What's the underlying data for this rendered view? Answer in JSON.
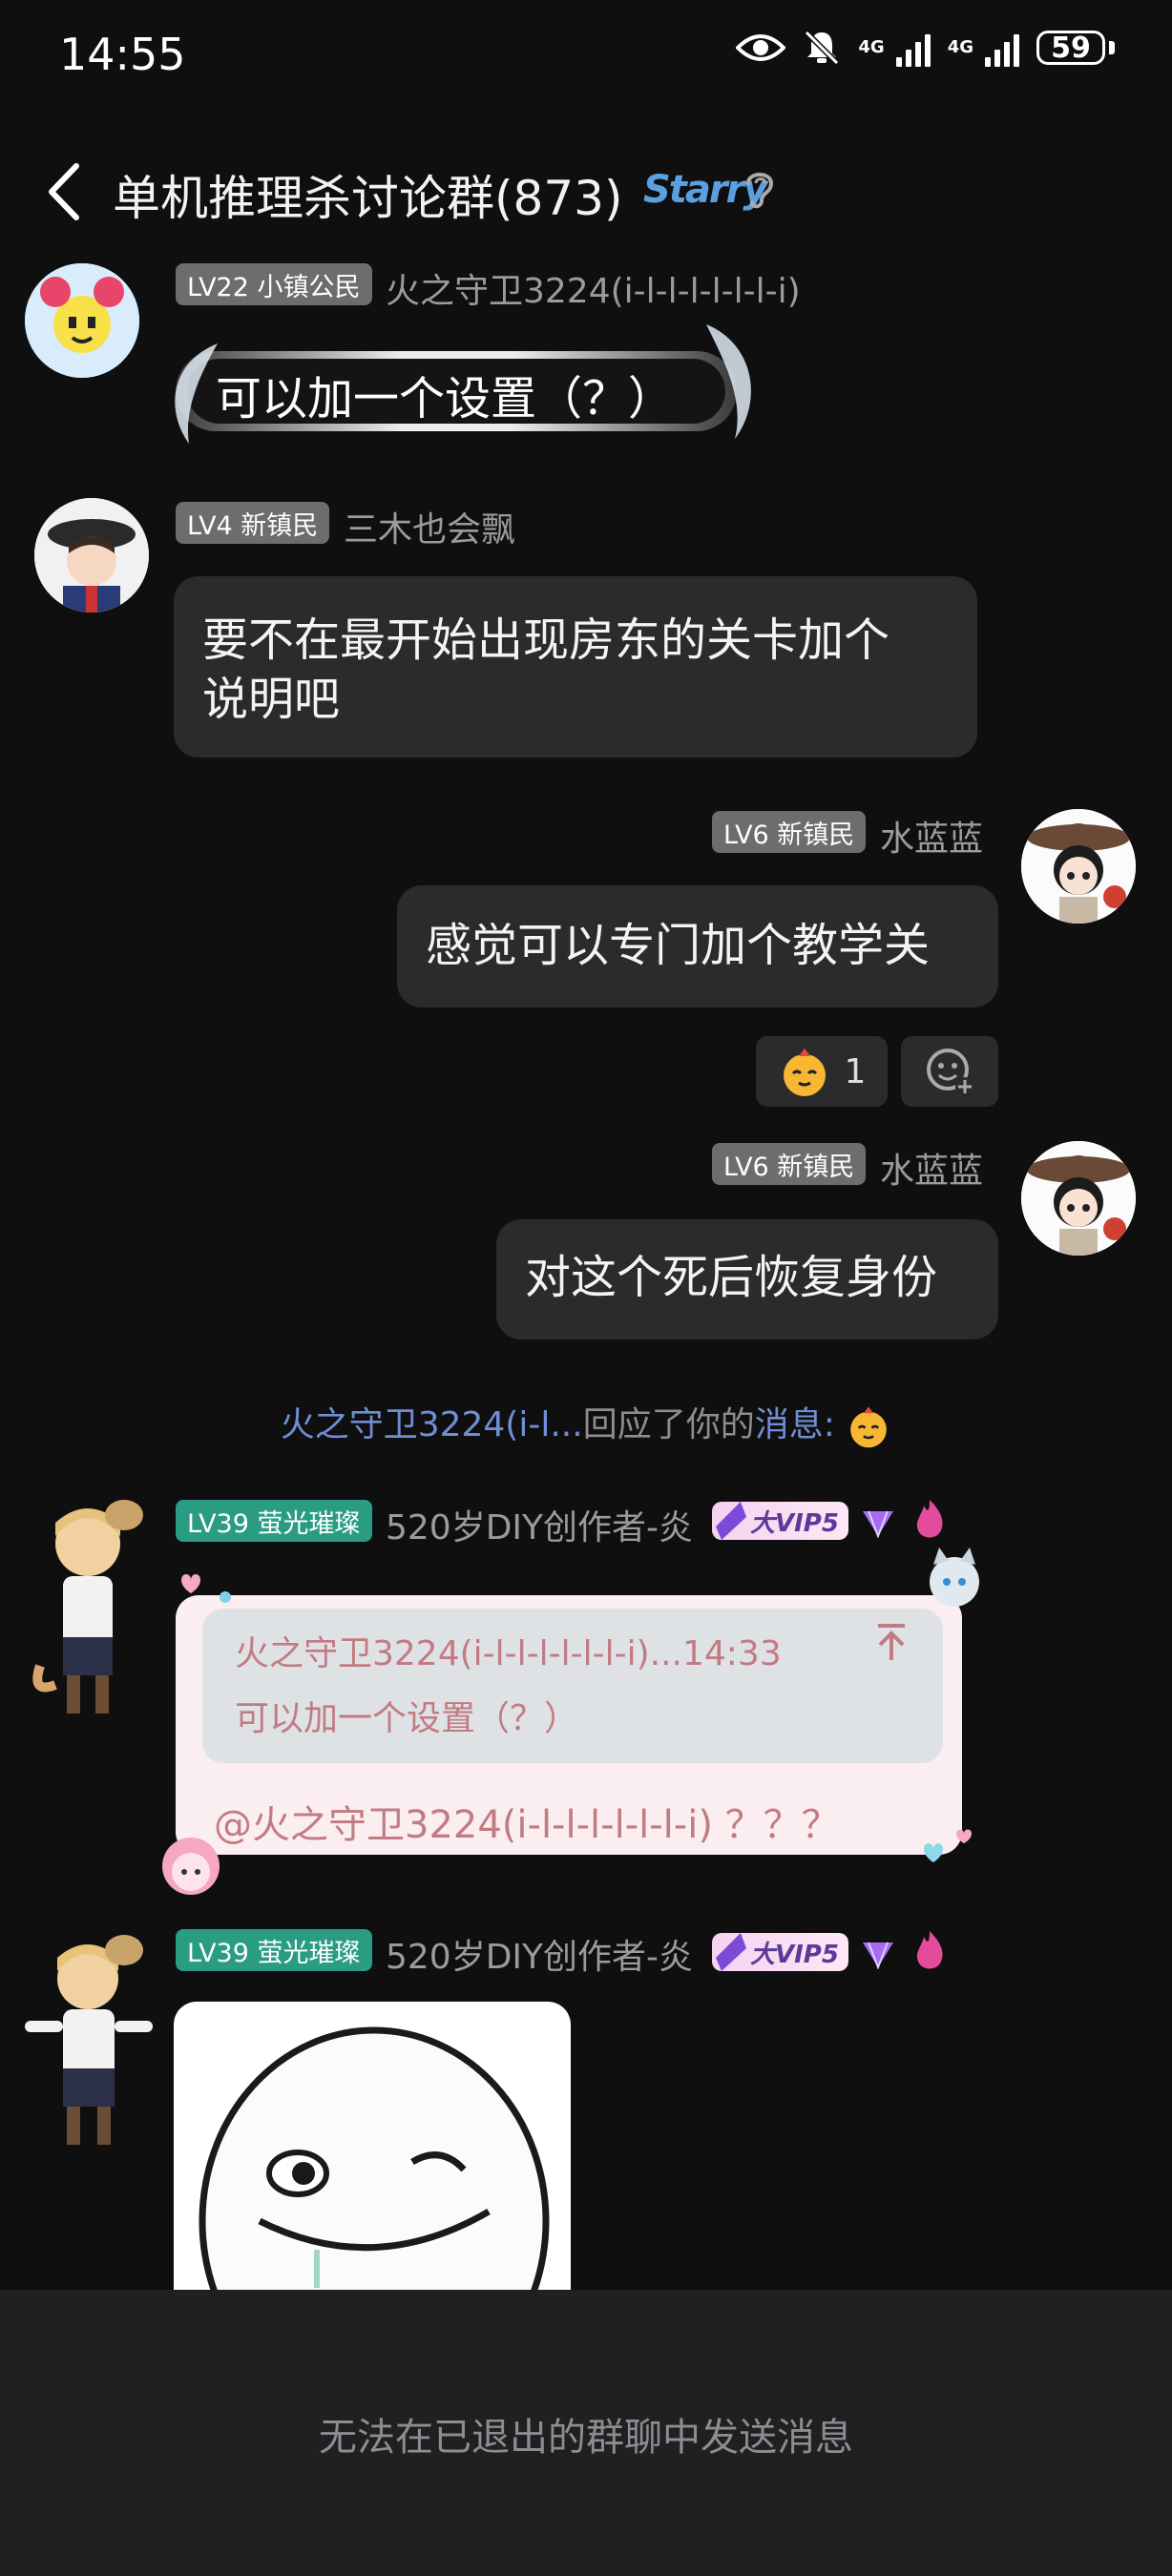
{
  "status_bar": {
    "time": "14:55",
    "net1": "4G",
    "net2": "4G",
    "battery": "59",
    "icons": [
      "eye-icon",
      "bell-mute-icon",
      "signal-icon",
      "battery-icon"
    ]
  },
  "header": {
    "title": "单机推理杀讨论群(873)",
    "badge": "Starry"
  },
  "messages": [
    {
      "level": "LV22 小镇公民",
      "nick": "火之守卫3224(i-l-l-l-l-l-l-i)",
      "text": "可以加一个设置（？）"
    },
    {
      "level": "LV4 新镇民",
      "nick": "三木也会飘",
      "text_line1": "要不在最开始出现房东的关卡加个",
      "text_line2": "说明吧"
    },
    {
      "level": "LV6 新镇民",
      "nick": "水蓝蓝",
      "text": "感觉可以专门加个教学关",
      "reaction_count": "1"
    },
    {
      "level": "LV6 新镇民",
      "nick": "水蓝蓝",
      "text": "对这个死后恢复身份"
    },
    {
      "level": "LV39 萤光璀璨",
      "nick": "520岁DIY创作者-炎",
      "vip": "大VIP5",
      "quote_head": "火之守卫3224(i-l-l-l-l-l-l-i)...14:33",
      "quote_text": "可以加一个设置（？）",
      "text": "@火之守卫3224(i-l-l-l-l-l-l-i) ？？？"
    },
    {
      "level": "LV39 萤光璀璨",
      "nick": "520岁DIY创作者-炎",
      "vip": "大VIP5"
    }
  ],
  "notice": {
    "name": "火之守卫3224(i-l...",
    "middle": "回应了你的",
    "link": "消息:"
  },
  "footer": {
    "text": "无法在已退出的群聊中发送消息"
  }
}
